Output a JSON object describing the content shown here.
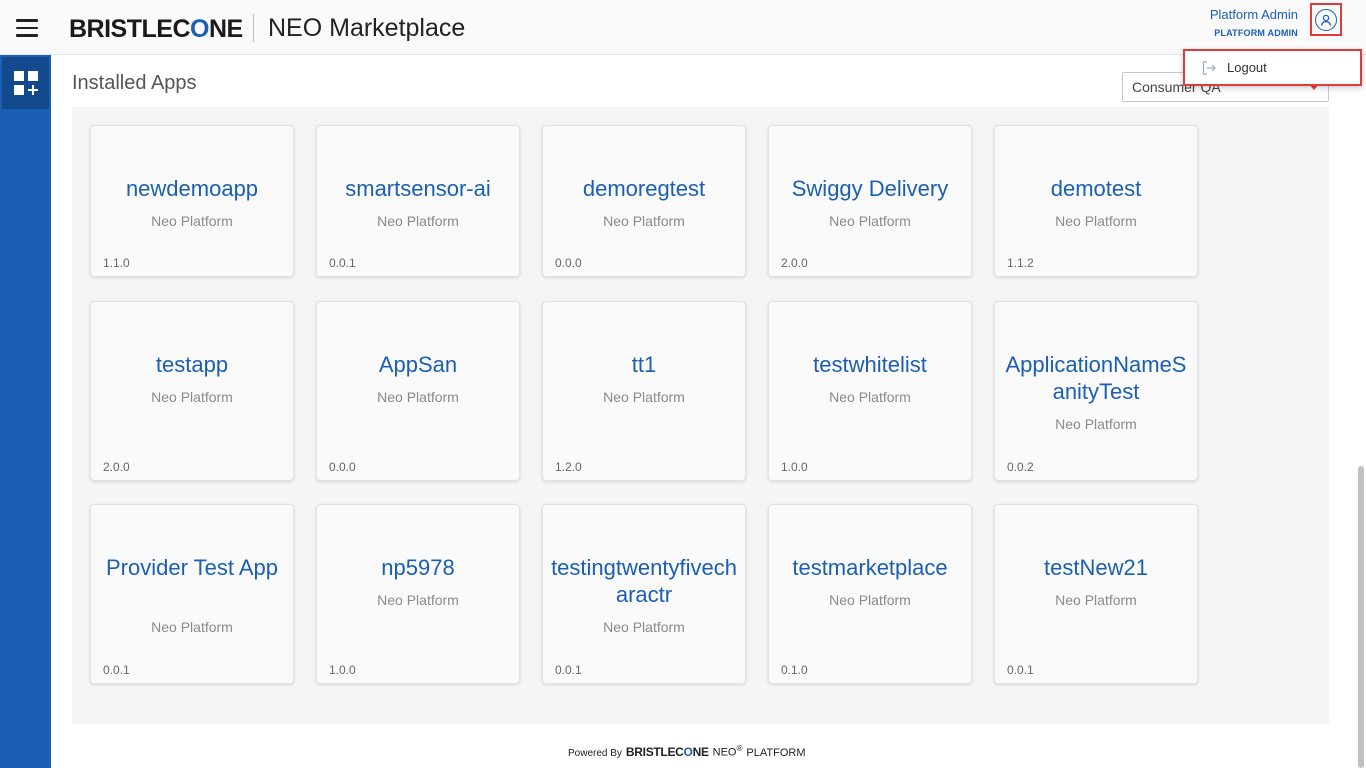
{
  "header": {
    "logo_text_pre": "BRISTLEC",
    "logo_text_o": "O",
    "logo_text_post": "NE",
    "app_title": "NEO Marketplace",
    "user_name": "Platform Admin",
    "user_role": "PLATFORM ADMIN"
  },
  "sidebar": {
    "items": [
      {
        "name": "apps-grid-add-icon"
      }
    ]
  },
  "main": {
    "title": "Installed Apps",
    "filter": {
      "value": "Consumer QA"
    }
  },
  "user_menu": {
    "logout_label": "Logout"
  },
  "apps": [
    {
      "name": "newdemoapp",
      "provider": "Neo Platform",
      "version": "1.1.0"
    },
    {
      "name": "smartsensor-ai",
      "provider": "Neo Platform",
      "version": "0.0.1"
    },
    {
      "name": "demoregtest",
      "provider": "Neo Platform",
      "version": "0.0.0"
    },
    {
      "name": "Swiggy Delivery",
      "provider": "Neo Platform",
      "version": "2.0.0"
    },
    {
      "name": "demotest",
      "provider": "Neo Platform",
      "version": "1.1.2"
    },
    {
      "name": "testapp",
      "provider": "Neo Platform",
      "version": "2.0.0"
    },
    {
      "name": "AppSan",
      "provider": "Neo Platform",
      "version": "0.0.0"
    },
    {
      "name": "tt1",
      "provider": "Neo Platform",
      "version": "1.2.0"
    },
    {
      "name": "testwhitelist",
      "provider": "Neo Platform",
      "version": "1.0.0"
    },
    {
      "name": "ApplicationNameSanityTest",
      "provider": "Neo Platform",
      "version": "0.0.2"
    },
    {
      "name": "Provider Test App",
      "provider": "Neo Platform",
      "version": "0.0.1"
    },
    {
      "name": "np5978",
      "provider": "Neo Platform",
      "version": "1.0.0"
    },
    {
      "name": "testingtwentyfivecharactr",
      "provider": "Neo Platform",
      "version": "0.0.1"
    },
    {
      "name": "testmarketplace",
      "provider": "Neo Platform",
      "version": "0.1.0"
    },
    {
      "name": "testNew21",
      "provider": "Neo Platform",
      "version": "0.0.1"
    }
  ],
  "footer": {
    "powered_by": "Powered By",
    "brand_pre": "BRISTLEC",
    "brand_o": "O",
    "brand_post": "NE",
    "neo": "NEO",
    "reg": "®",
    "platform": "PLATFORM"
  },
  "colors": {
    "accent": "#1a5fb4",
    "highlight": "#e03a3a"
  }
}
